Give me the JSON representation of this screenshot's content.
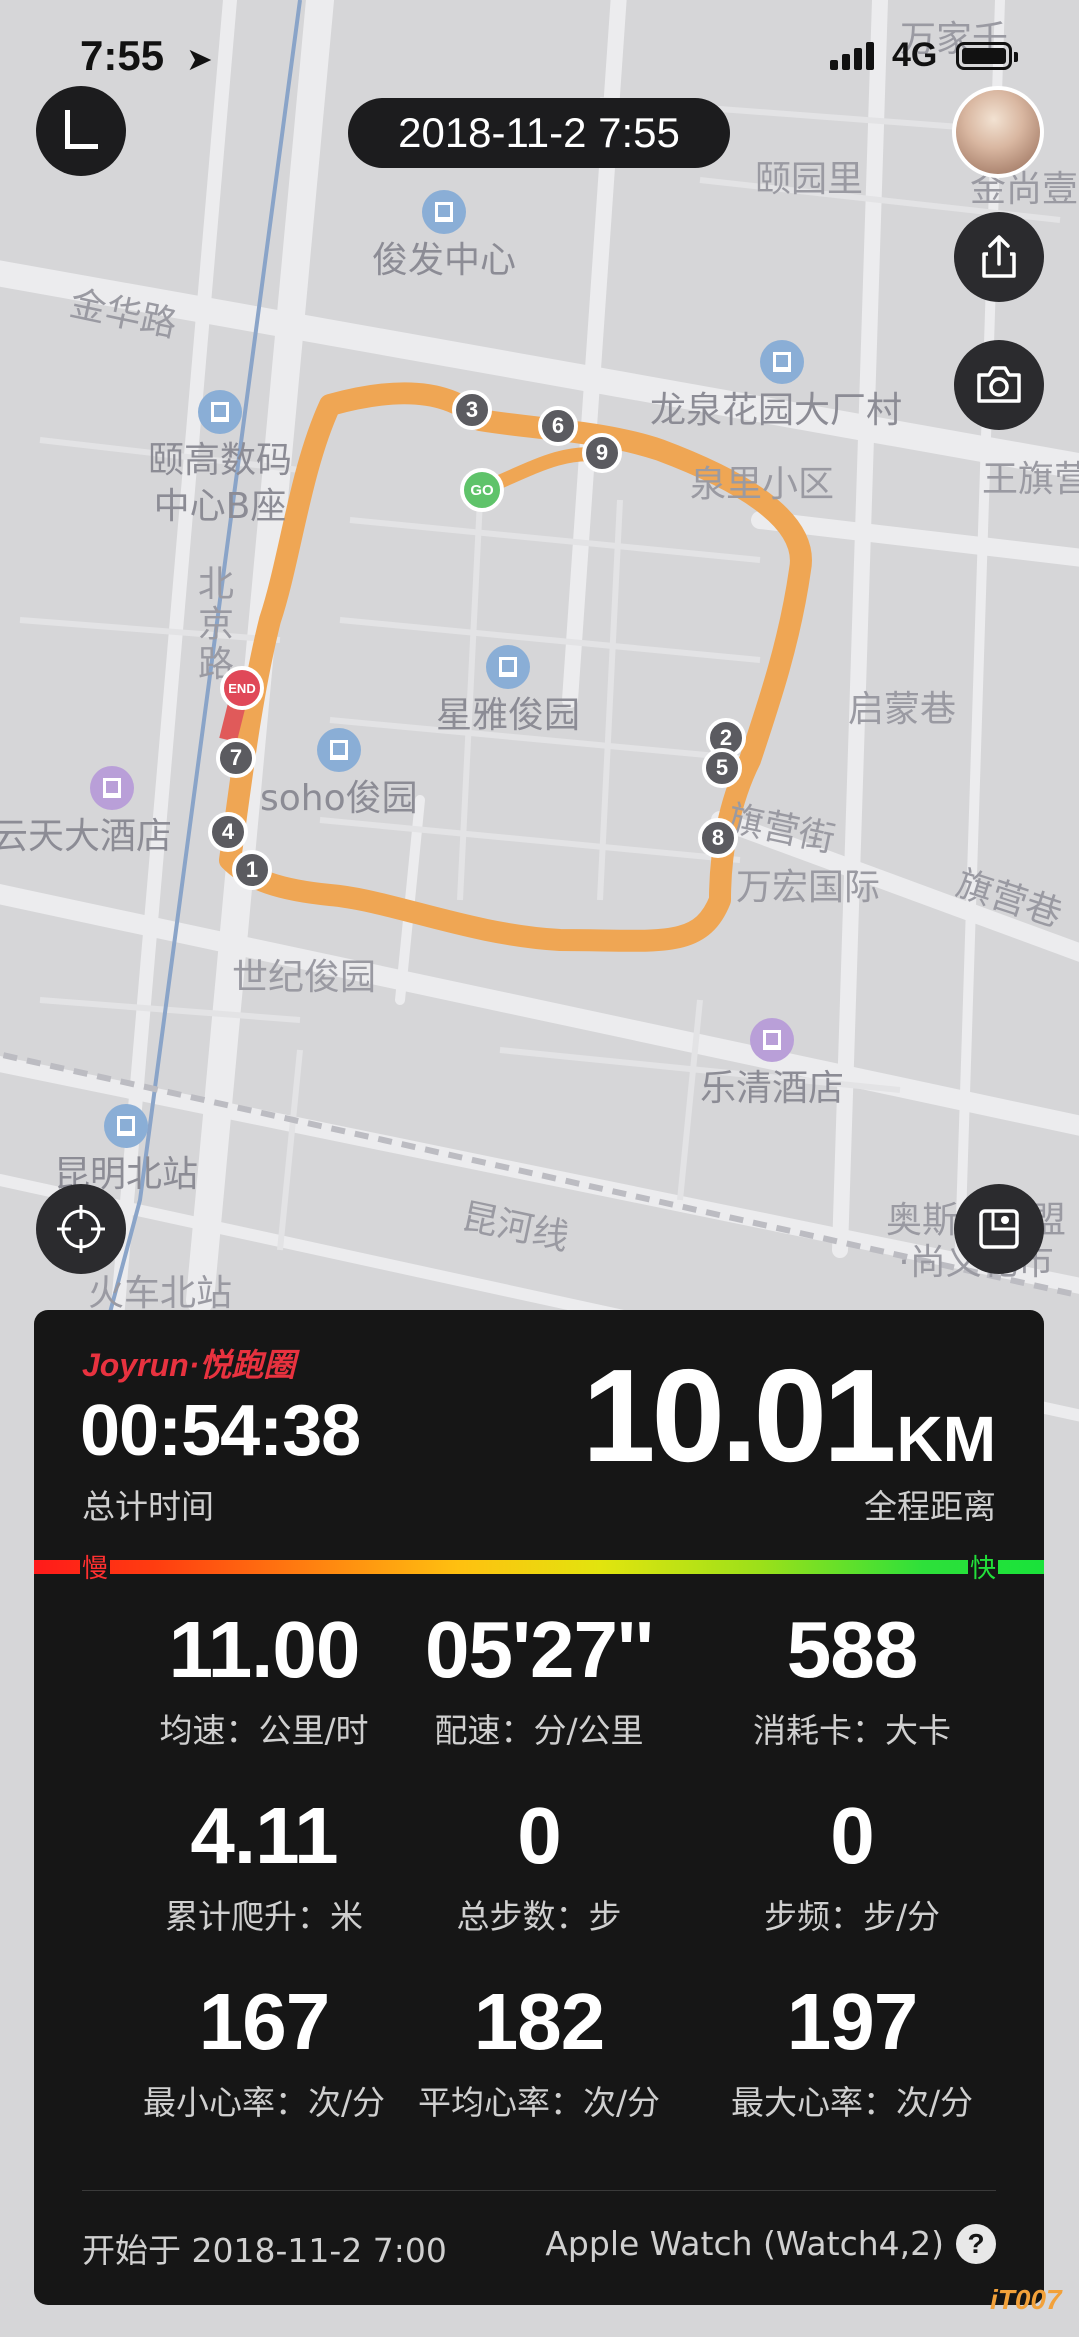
{
  "status_bar": {
    "time": "7:55",
    "network": "4G"
  },
  "header": {
    "date_time": "2018-11-2 7:55"
  },
  "map": {
    "labels": {
      "fenhu": "颐园里",
      "junfa": "俊发中心",
      "jinhua": "金华路",
      "yigao": "颐高数码\n中心B座",
      "longquan": "龙泉花园大厂村",
      "quanli": "泉里小区",
      "wangqi": "王旗营",
      "beijing": "北京路",
      "xingya": "星雅俊园",
      "qimeng": "启蒙巷",
      "soho": "soho俊园",
      "yuntian": "云天大酒店",
      "qiying": "旗营街",
      "wanhong": "万宏国际",
      "qiying2": "旗营巷",
      "shiji": "世纪俊园",
      "leqing": "乐清酒店",
      "kunming": "昆明北站",
      "huoche": "火车北站",
      "aosi": "奥斯迪联盟\n·尚义花市",
      "kunhe": "昆河线",
      "jinshang": "金尚壹",
      "wangjia": "万家千"
    },
    "route_color": "#efa654",
    "markers": [
      "1",
      "2",
      "3",
      "4",
      "5",
      "6",
      "7",
      "8",
      "9"
    ],
    "go_label": "GO",
    "end_label": "END"
  },
  "panel": {
    "brand": "Joyrun·悦跑圈",
    "total_time": "00:54:38",
    "total_time_label": "总计时间",
    "distance_value": "10.01",
    "distance_unit": "KM",
    "distance_label": "全程距离",
    "slow_label": "慢",
    "fast_label": "快",
    "stats": [
      {
        "value": "11.00",
        "label": "均速：公里/时"
      },
      {
        "value": "05'27''",
        "label": "配速：分/公里"
      },
      {
        "value": "588",
        "label": "消耗卡：大卡"
      },
      {
        "value": "4.11",
        "label": "累计爬升：米"
      },
      {
        "value": "0",
        "label": "总步数：步"
      },
      {
        "value": "0",
        "label": "步频：步/分"
      },
      {
        "value": "167",
        "label": "最小心率：次/分"
      },
      {
        "value": "182",
        "label": "平均心率：次/分"
      },
      {
        "value": "197",
        "label": "最大心率：次/分"
      }
    ],
    "start_text": "开始于 2018-11-2 7:00",
    "device_text": "Apple Watch (Watch4,2)",
    "help": "?"
  },
  "watermark": "iT007"
}
